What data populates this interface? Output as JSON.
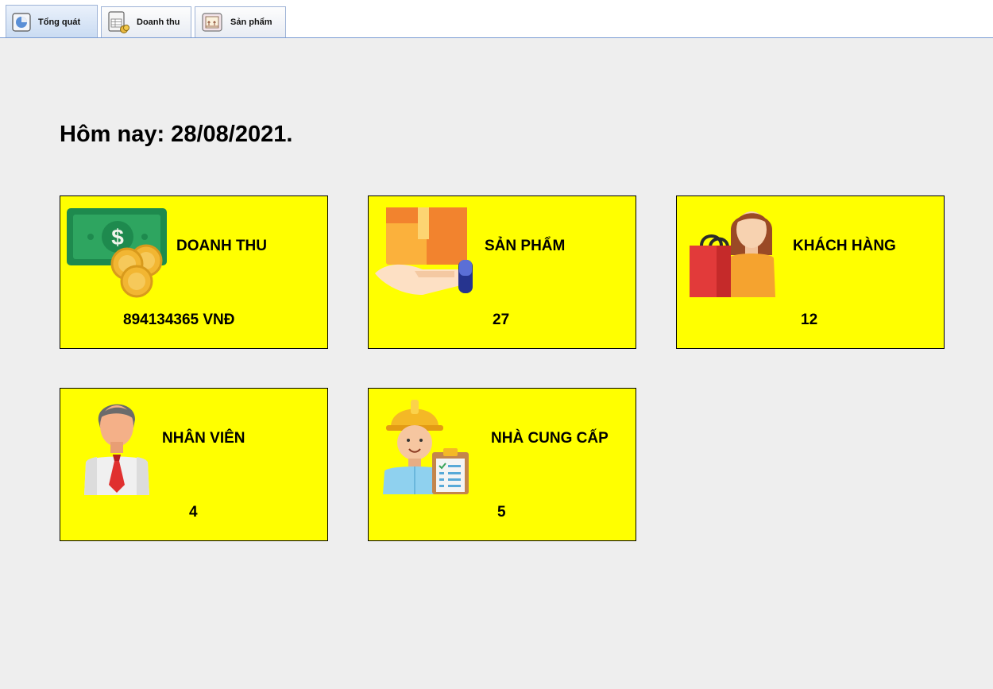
{
  "tabs": [
    {
      "label": "Tổng quát",
      "icon": "pie-chart-icon",
      "active": true
    },
    {
      "label": "Doanh thu",
      "icon": "spreadsheet-coin-icon",
      "active": false
    },
    {
      "label": "Sản phẩm",
      "icon": "box-icon",
      "active": false
    }
  ],
  "header": {
    "today": "Hôm nay: 28/08/2021."
  },
  "cards": {
    "revenue": {
      "title": "DOANH THU",
      "value": "894134365 VNĐ",
      "icon": "money-coins-icon"
    },
    "products": {
      "title": "SẢN PHẨM",
      "value": "27",
      "icon": "box-in-hand-icon"
    },
    "customers": {
      "title": "KHÁCH HÀNG",
      "value": "12",
      "icon": "shopper-woman-icon"
    },
    "employees": {
      "title": "NHÂN VIÊN",
      "value": "4",
      "icon": "businessman-icon"
    },
    "suppliers": {
      "title": "NHÀ CUNG CẤP",
      "value": "5",
      "icon": "worker-clipboard-icon"
    }
  },
  "colors": {
    "card_bg": "#ffff00",
    "page_bg": "#eeeeee",
    "tab_border": "#9eb3d6"
  }
}
